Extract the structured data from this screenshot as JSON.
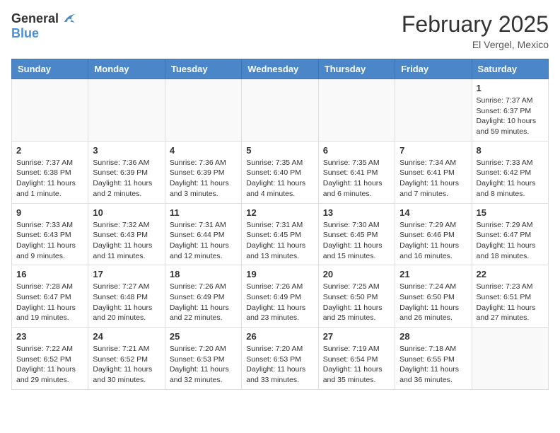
{
  "header": {
    "logo_general": "General",
    "logo_blue": "Blue",
    "month": "February 2025",
    "location": "El Vergel, Mexico"
  },
  "weekdays": [
    "Sunday",
    "Monday",
    "Tuesday",
    "Wednesday",
    "Thursday",
    "Friday",
    "Saturday"
  ],
  "weeks": [
    [
      {
        "day": "",
        "info": ""
      },
      {
        "day": "",
        "info": ""
      },
      {
        "day": "",
        "info": ""
      },
      {
        "day": "",
        "info": ""
      },
      {
        "day": "",
        "info": ""
      },
      {
        "day": "",
        "info": ""
      },
      {
        "day": "1",
        "info": "Sunrise: 7:37 AM\nSunset: 6:37 PM\nDaylight: 10 hours and 59 minutes."
      }
    ],
    [
      {
        "day": "2",
        "info": "Sunrise: 7:37 AM\nSunset: 6:38 PM\nDaylight: 11 hours and 1 minute."
      },
      {
        "day": "3",
        "info": "Sunrise: 7:36 AM\nSunset: 6:39 PM\nDaylight: 11 hours and 2 minutes."
      },
      {
        "day": "4",
        "info": "Sunrise: 7:36 AM\nSunset: 6:39 PM\nDaylight: 11 hours and 3 minutes."
      },
      {
        "day": "5",
        "info": "Sunrise: 7:35 AM\nSunset: 6:40 PM\nDaylight: 11 hours and 4 minutes."
      },
      {
        "day": "6",
        "info": "Sunrise: 7:35 AM\nSunset: 6:41 PM\nDaylight: 11 hours and 6 minutes."
      },
      {
        "day": "7",
        "info": "Sunrise: 7:34 AM\nSunset: 6:41 PM\nDaylight: 11 hours and 7 minutes."
      },
      {
        "day": "8",
        "info": "Sunrise: 7:33 AM\nSunset: 6:42 PM\nDaylight: 11 hours and 8 minutes."
      }
    ],
    [
      {
        "day": "9",
        "info": "Sunrise: 7:33 AM\nSunset: 6:43 PM\nDaylight: 11 hours and 9 minutes."
      },
      {
        "day": "10",
        "info": "Sunrise: 7:32 AM\nSunset: 6:43 PM\nDaylight: 11 hours and 11 minutes."
      },
      {
        "day": "11",
        "info": "Sunrise: 7:31 AM\nSunset: 6:44 PM\nDaylight: 11 hours and 12 minutes."
      },
      {
        "day": "12",
        "info": "Sunrise: 7:31 AM\nSunset: 6:45 PM\nDaylight: 11 hours and 13 minutes."
      },
      {
        "day": "13",
        "info": "Sunrise: 7:30 AM\nSunset: 6:45 PM\nDaylight: 11 hours and 15 minutes."
      },
      {
        "day": "14",
        "info": "Sunrise: 7:29 AM\nSunset: 6:46 PM\nDaylight: 11 hours and 16 minutes."
      },
      {
        "day": "15",
        "info": "Sunrise: 7:29 AM\nSunset: 6:47 PM\nDaylight: 11 hours and 18 minutes."
      }
    ],
    [
      {
        "day": "16",
        "info": "Sunrise: 7:28 AM\nSunset: 6:47 PM\nDaylight: 11 hours and 19 minutes."
      },
      {
        "day": "17",
        "info": "Sunrise: 7:27 AM\nSunset: 6:48 PM\nDaylight: 11 hours and 20 minutes."
      },
      {
        "day": "18",
        "info": "Sunrise: 7:26 AM\nSunset: 6:49 PM\nDaylight: 11 hours and 22 minutes."
      },
      {
        "day": "19",
        "info": "Sunrise: 7:26 AM\nSunset: 6:49 PM\nDaylight: 11 hours and 23 minutes."
      },
      {
        "day": "20",
        "info": "Sunrise: 7:25 AM\nSunset: 6:50 PM\nDaylight: 11 hours and 25 minutes."
      },
      {
        "day": "21",
        "info": "Sunrise: 7:24 AM\nSunset: 6:50 PM\nDaylight: 11 hours and 26 minutes."
      },
      {
        "day": "22",
        "info": "Sunrise: 7:23 AM\nSunset: 6:51 PM\nDaylight: 11 hours and 27 minutes."
      }
    ],
    [
      {
        "day": "23",
        "info": "Sunrise: 7:22 AM\nSunset: 6:52 PM\nDaylight: 11 hours and 29 minutes."
      },
      {
        "day": "24",
        "info": "Sunrise: 7:21 AM\nSunset: 6:52 PM\nDaylight: 11 hours and 30 minutes."
      },
      {
        "day": "25",
        "info": "Sunrise: 7:20 AM\nSunset: 6:53 PM\nDaylight: 11 hours and 32 minutes."
      },
      {
        "day": "26",
        "info": "Sunrise: 7:20 AM\nSunset: 6:53 PM\nDaylight: 11 hours and 33 minutes."
      },
      {
        "day": "27",
        "info": "Sunrise: 7:19 AM\nSunset: 6:54 PM\nDaylight: 11 hours and 35 minutes."
      },
      {
        "day": "28",
        "info": "Sunrise: 7:18 AM\nSunset: 6:55 PM\nDaylight: 11 hours and 36 minutes."
      },
      {
        "day": "",
        "info": ""
      }
    ]
  ]
}
